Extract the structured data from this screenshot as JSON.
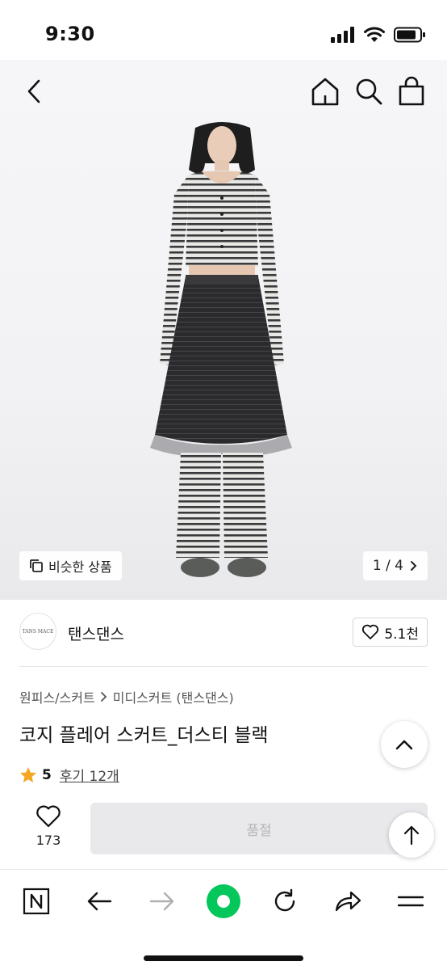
{
  "status_bar": {
    "time": "9:30"
  },
  "nav": {
    "back_icon": "chevron-left-icon",
    "home_icon": "home-icon",
    "search_icon": "search-icon",
    "bag_icon": "shopping-bag-icon"
  },
  "hero": {
    "similar_label": "비슷한 상품",
    "page_current": "1",
    "page_total": "4",
    "page_display": "1 / 4"
  },
  "brand": {
    "logo_text": "TANS MACE",
    "name": "탠스댄스",
    "like_count": "5.1천"
  },
  "product": {
    "breadcrumb": [
      "원피스/스커트",
      "미디스커트 (탠스댄스)"
    ],
    "title": "코지 플레어 스커트_더스티 블랙",
    "rating": "5",
    "review_link": "후기 12개"
  },
  "actions": {
    "wish_count": "173",
    "buy_label": "품절"
  },
  "colors": {
    "accent_star": "#f5a623",
    "browser_green": "#03c75a",
    "disabled_button": "#e9e9ec"
  },
  "browser_bar": {
    "icons": [
      "naver-n-icon",
      "back-arrow-icon",
      "forward-arrow-icon",
      "green-circle-icon",
      "refresh-icon",
      "share-icon",
      "menu-icon"
    ]
  }
}
